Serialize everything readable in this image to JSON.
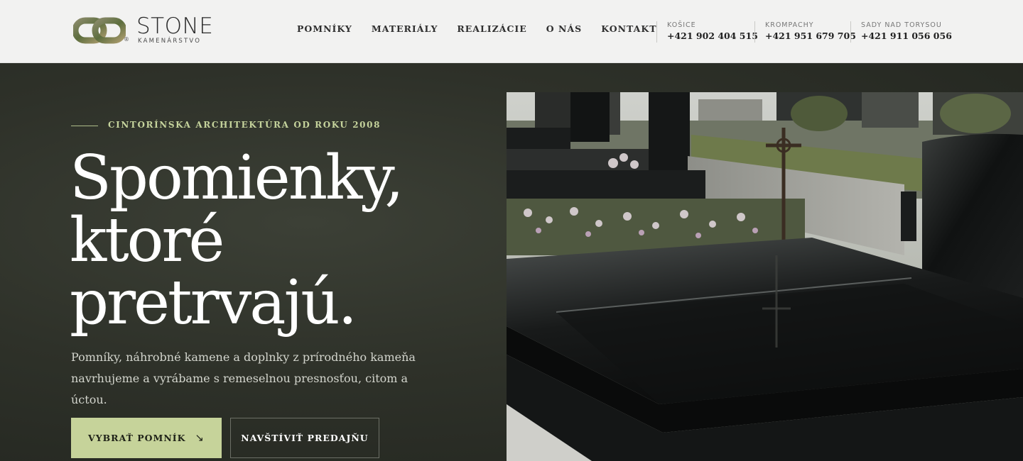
{
  "brand": {
    "name": "STONE",
    "tagline": "KAMENÁRSTVO",
    "registered": "®"
  },
  "nav": {
    "items": [
      {
        "label": "POMNÍKY"
      },
      {
        "label": "MATERIÁLY"
      },
      {
        "label": "REALIZÁCIE"
      },
      {
        "label": "O NÁS"
      },
      {
        "label": "KONTAKT"
      }
    ]
  },
  "contacts": [
    {
      "city": "KOŠICE",
      "phone": "+421 902 404 515"
    },
    {
      "city": "KROMPACHY",
      "phone": "+421 951 679 705"
    },
    {
      "city": "SADY NAD TORYSOU",
      "phone": "+421 911 056 056"
    }
  ],
  "hero": {
    "eyebrow": "CINTORÍNSKA ARCHITEKTÚRA OD ROKU 2008",
    "headline_1": "Spomienky,",
    "headline_2": "ktoré",
    "headline_3": "pretrvajú.",
    "lead_1": "Pomníky, náhrobné kamene a doplnky z prírodného kameňa",
    "lead_2": "navrhujeme a vyrábame s remeselnou presnosťou, citom a úctou.",
    "primary_cta": "VYBRAŤ POMNÍK",
    "primary_cta_arrow": "↘",
    "secondary_cta": "NAVŠTÍVIŤ PREDAJŇU"
  },
  "colors": {
    "header_bg": "#f2f2f1",
    "hero_bg": "#2e3129",
    "accent": "#c6d39a",
    "eyebrow": "#c5d39c"
  }
}
